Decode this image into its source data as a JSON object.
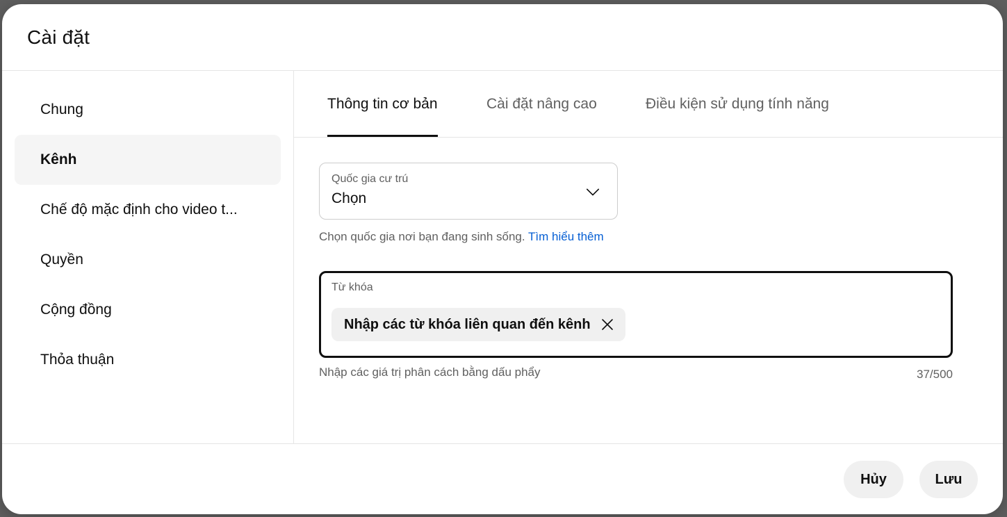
{
  "dialog": {
    "title": "Cài đặt"
  },
  "sidebar": {
    "items": [
      {
        "label": "Chung"
      },
      {
        "label": "Kênh",
        "active": true
      },
      {
        "label": "Chế độ mặc định cho video t..."
      },
      {
        "label": "Quyền"
      },
      {
        "label": "Cộng đồng"
      },
      {
        "label": "Thỏa thuận"
      }
    ]
  },
  "tabs": [
    {
      "label": "Thông tin cơ bản",
      "active": true
    },
    {
      "label": "Cài đặt nâng cao"
    },
    {
      "label": "Điều kiện sử dụng tính năng"
    }
  ],
  "country_field": {
    "label": "Quốc gia cư trú",
    "value": "Chọn",
    "help_text": "Chọn quốc gia nơi bạn đang sinh sống.",
    "help_link": "Tìm hiểu thêm"
  },
  "keywords_field": {
    "label": "Từ khóa",
    "chips": [
      {
        "text": "Nhập các từ khóa liên quan đến kênh"
      }
    ],
    "hint": "Nhập các giá trị phân cách bằng dấu phẩy",
    "counter": "37/500"
  },
  "footer": {
    "cancel_label": "Hủy",
    "save_label": "Lưu"
  },
  "colors": {
    "link": "#065fd4",
    "text_primary": "#0f0f0f",
    "text_secondary": "#606060",
    "active_bg": "#f5f5f5",
    "button_bg": "#f0f0f0"
  }
}
